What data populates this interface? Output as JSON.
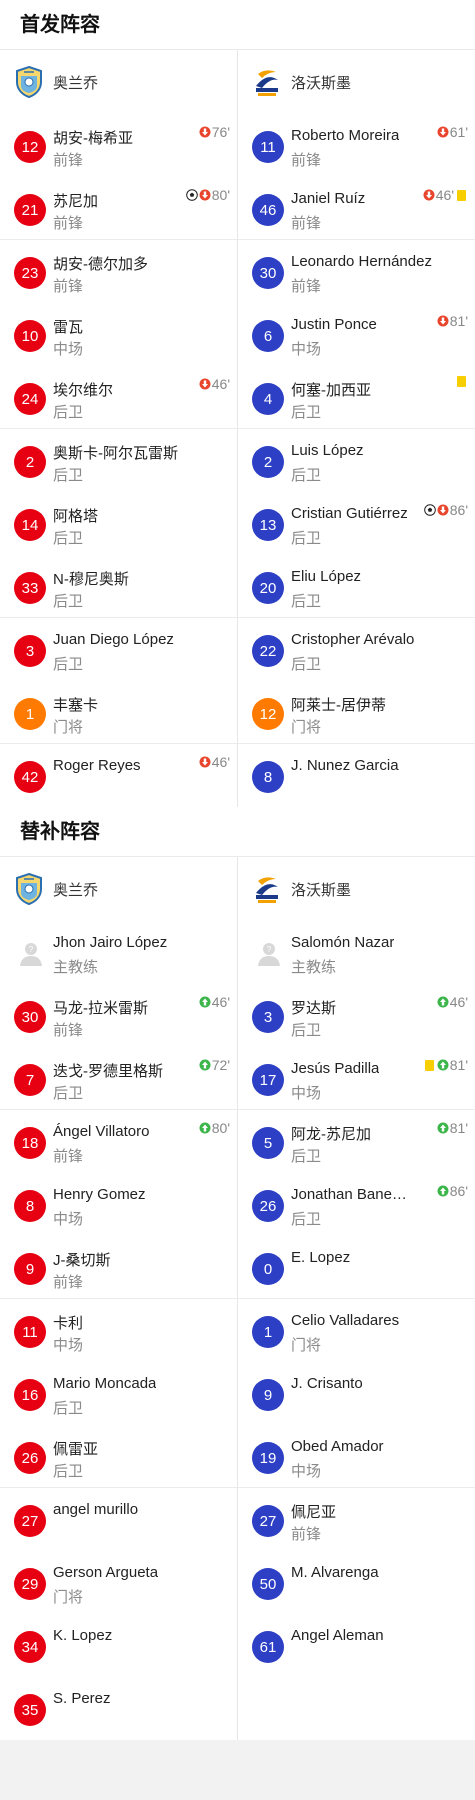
{
  "starting": {
    "title": "首发阵容",
    "home": {
      "team": "奥兰乔",
      "players": [
        {
          "num": "12",
          "name": "胡安-梅希亚",
          "pos": "前锋",
          "events": [
            {
              "type": "sub-out"
            }
          ],
          "minute": "76'"
        },
        {
          "num": "21",
          "name": "苏尼加",
          "pos": "前锋",
          "events": [
            {
              "type": "goal"
            },
            {
              "type": "sub-out"
            }
          ],
          "minute": "80'"
        },
        {
          "num": "23",
          "name": "胡安-德尔加多",
          "pos": "前锋",
          "events": [],
          "minute": ""
        },
        {
          "num": "10",
          "name": "雷瓦",
          "pos": "中场",
          "events": [],
          "minute": ""
        },
        {
          "num": "24",
          "name": "埃尔维尔",
          "pos": "后卫",
          "events": [
            {
              "type": "sub-out"
            }
          ],
          "minute": "46'"
        },
        {
          "num": "2",
          "name": "奥斯卡-阿尔瓦雷斯",
          "pos": "后卫",
          "events": [],
          "minute": ""
        },
        {
          "num": "14",
          "name": "阿格塔",
          "pos": "后卫",
          "events": [],
          "minute": ""
        },
        {
          "num": "33",
          "name": "N-穆尼奥斯",
          "pos": "后卫",
          "events": [],
          "minute": ""
        },
        {
          "num": "3",
          "name": "Juan Diego López",
          "pos": "后卫",
          "events": [],
          "minute": ""
        },
        {
          "num": "1",
          "name": "丰塞卡",
          "pos": "门将",
          "events": [],
          "minute": "",
          "gk": true
        },
        {
          "num": "42",
          "name": "Roger Reyes",
          "pos": "",
          "events": [
            {
              "type": "sub-out"
            }
          ],
          "minute": "46'"
        }
      ]
    },
    "away": {
      "team": "洛沃斯墨",
      "players": [
        {
          "num": "11",
          "name": "Roberto Moreira",
          "pos": "前锋",
          "events": [
            {
              "type": "sub-out"
            }
          ],
          "minute": "61'"
        },
        {
          "num": "46",
          "name": "Janiel Ruíz",
          "pos": "前锋",
          "events": [
            {
              "type": "sub-out"
            }
          ],
          "minute": "46'",
          "card": "yellow"
        },
        {
          "num": "30",
          "name": "Leonardo Hernández",
          "pos": "前锋",
          "events": [],
          "minute": ""
        },
        {
          "num": "6",
          "name": "Justin Ponce",
          "pos": "中场",
          "events": [
            {
              "type": "sub-out"
            }
          ],
          "minute": "81'"
        },
        {
          "num": "4",
          "name": "何塞-加西亚",
          "pos": "后卫",
          "events": [],
          "minute": "",
          "card": "yellow"
        },
        {
          "num": "2",
          "name": "Luis López",
          "pos": "后卫",
          "events": [],
          "minute": ""
        },
        {
          "num": "13",
          "name": "Cristian Gutiérrez",
          "pos": "后卫",
          "events": [
            {
              "type": "goal"
            },
            {
              "type": "sub-out"
            }
          ],
          "minute": "86'"
        },
        {
          "num": "20",
          "name": "Eliu López",
          "pos": "后卫",
          "events": [],
          "minute": ""
        },
        {
          "num": "22",
          "name": "Cristopher Arévalo",
          "pos": "后卫",
          "events": [],
          "minute": ""
        },
        {
          "num": "12",
          "name": "阿莱士-居伊蒂",
          "pos": "门将",
          "events": [],
          "minute": "",
          "gk": true
        },
        {
          "num": "8",
          "name": "J. Nunez Garcia",
          "pos": "",
          "events": [],
          "minute": ""
        }
      ]
    }
  },
  "subs": {
    "title": "替补阵容",
    "home": {
      "team": "奥兰乔",
      "coach": {
        "name": "Jhon Jairo López",
        "role": "主教练"
      },
      "players": [
        {
          "num": "30",
          "name": "马龙-拉米雷斯",
          "pos": "前锋",
          "events": [
            {
              "type": "sub-in"
            }
          ],
          "minute": "46'"
        },
        {
          "num": "7",
          "name": "迭戈-罗德里格斯",
          "pos": "后卫",
          "events": [
            {
              "type": "sub-in"
            }
          ],
          "minute": "72'"
        },
        {
          "num": "18",
          "name": "Ángel Villatoro",
          "pos": "前锋",
          "events": [
            {
              "type": "sub-in"
            }
          ],
          "minute": "80'"
        },
        {
          "num": "8",
          "name": "Henry Gomez",
          "pos": "中场",
          "events": [],
          "minute": ""
        },
        {
          "num": "9",
          "name": "J-桑切斯",
          "pos": "前锋",
          "events": [],
          "minute": ""
        },
        {
          "num": "11",
          "name": "卡利",
          "pos": "中场",
          "events": [],
          "minute": ""
        },
        {
          "num": "16",
          "name": "Mario Moncada",
          "pos": "后卫",
          "events": [],
          "minute": ""
        },
        {
          "num": "26",
          "name": "佩雷亚",
          "pos": "后卫",
          "events": [],
          "minute": ""
        },
        {
          "num": "27",
          "name": "angel murillo",
          "pos": "",
          "events": [],
          "minute": ""
        },
        {
          "num": "29",
          "name": "Gerson Argueta",
          "pos": "门将",
          "events": [],
          "minute": ""
        },
        {
          "num": "34",
          "name": "K. Lopez",
          "pos": "",
          "events": [],
          "minute": ""
        },
        {
          "num": "35",
          "name": "S. Perez",
          "pos": "",
          "events": [],
          "minute": ""
        }
      ]
    },
    "away": {
      "team": "洛沃斯墨",
      "coach": {
        "name": "Salomón Nazar",
        "role": "主教练"
      },
      "players": [
        {
          "num": "3",
          "name": "罗达斯",
          "pos": "后卫",
          "events": [
            {
              "type": "sub-in"
            }
          ],
          "minute": "46'"
        },
        {
          "num": "17",
          "name": "Jesús Padilla",
          "pos": "中场",
          "events": [
            {
              "type": "sub-in"
            }
          ],
          "minute": "81'",
          "card": "yellow"
        },
        {
          "num": "5",
          "name": "阿龙-苏尼加",
          "pos": "后卫",
          "events": [
            {
              "type": "sub-in"
            }
          ],
          "minute": "81'"
        },
        {
          "num": "26",
          "name": "Jonathan Banegas",
          "pos": "后卫",
          "events": [
            {
              "type": "sub-in"
            }
          ],
          "minute": "86'"
        },
        {
          "num": "0",
          "name": "E. Lopez",
          "pos": "",
          "events": [],
          "minute": ""
        },
        {
          "num": "1",
          "name": "Celio Valladares",
          "pos": "门将",
          "events": [],
          "minute": ""
        },
        {
          "num": "9",
          "name": "J. Crisanto",
          "pos": "",
          "events": [],
          "minute": ""
        },
        {
          "num": "19",
          "name": "Obed Amador",
          "pos": "中场",
          "events": [],
          "minute": ""
        },
        {
          "num": "27",
          "name": "佩尼亚",
          "pos": "前锋",
          "events": [],
          "minute": ""
        },
        {
          "num": "50",
          "name": "M. Alvarenga",
          "pos": "",
          "events": [],
          "minute": ""
        },
        {
          "num": "61",
          "name": "Angel Aleman",
          "pos": "",
          "events": [],
          "minute": ""
        }
      ]
    }
  },
  "colors": {
    "home_number": "#e60012",
    "away_number": "#2d3fc4",
    "goalkeeper_number": "#ff7a00",
    "sub_out": "#e8452c",
    "sub_in": "#3cb54a",
    "yellow_card": "#f7cf00"
  }
}
